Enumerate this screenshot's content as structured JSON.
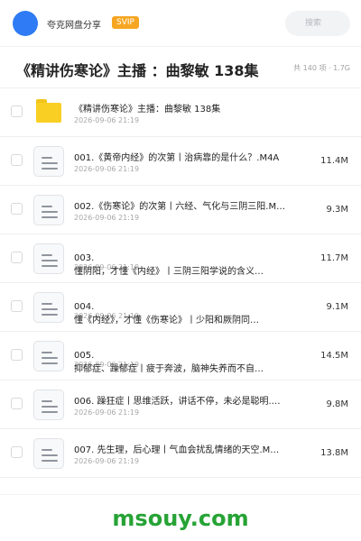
{
  "header": {
    "username": "夸克网盘分享",
    "badge": "SVIP",
    "search_placeholder": "搜索",
    "avatar_color": "#2f7bf5"
  },
  "page": {
    "title": "《精讲伤寒论》主播 ：曲黎敏 138集",
    "summary": "共 140 项 · 1.7G"
  },
  "files": [
    {
      "type": "folder",
      "name": "《精讲伤寒论》主播：曲黎敏 138集",
      "date": "2026-09-06 21:19",
      "size": ""
    },
    {
      "type": "doc",
      "name": "001.《黄帝内经》的次第丨治病靠的是什么？.M4A",
      "date": "2026-09-06 21:19",
      "size": "11.4M"
    },
    {
      "type": "doc",
      "name": "002.《伤寒论》的次第丨六经、气化与三阴三阳.M…",
      "date": "2026-09-06 21:19",
      "size": "9.3M"
    },
    {
      "type": "doc",
      "name": "003.",
      "name2": "懂阴阳，才懂《内经》丨三阴三阳学说的含义…",
      "date": "2026-09-06 21:19",
      "size": "11.7M"
    },
    {
      "type": "doc",
      "name": "004.",
      "name2": "懂《内经》，才懂《伤寒论》丨少阳和厥阴同…",
      "date": "2026-09-06 21:19",
      "size": "9.1M"
    },
    {
      "type": "doc",
      "name": "005.",
      "name2": "抑郁症、躁郁症丨疲于奔波，脑神失养而不自…",
      "date": "2026-09-06 21:19",
      "size": "14.5M"
    },
    {
      "type": "doc",
      "name": "006. 躁狂症丨思维活跃，讲话不停，未必是聪明.…",
      "date": "2026-09-06 21:19",
      "size": "9.8M"
    },
    {
      "type": "doc",
      "name": "007. 先生理，后心理丨气血会扰乱情绪的天空.M…",
      "date": "2026-09-06 21:19",
      "size": "13.8M"
    }
  ],
  "footer": {
    "watermark": "msouy.com",
    "watermark_color": "#27a336"
  }
}
